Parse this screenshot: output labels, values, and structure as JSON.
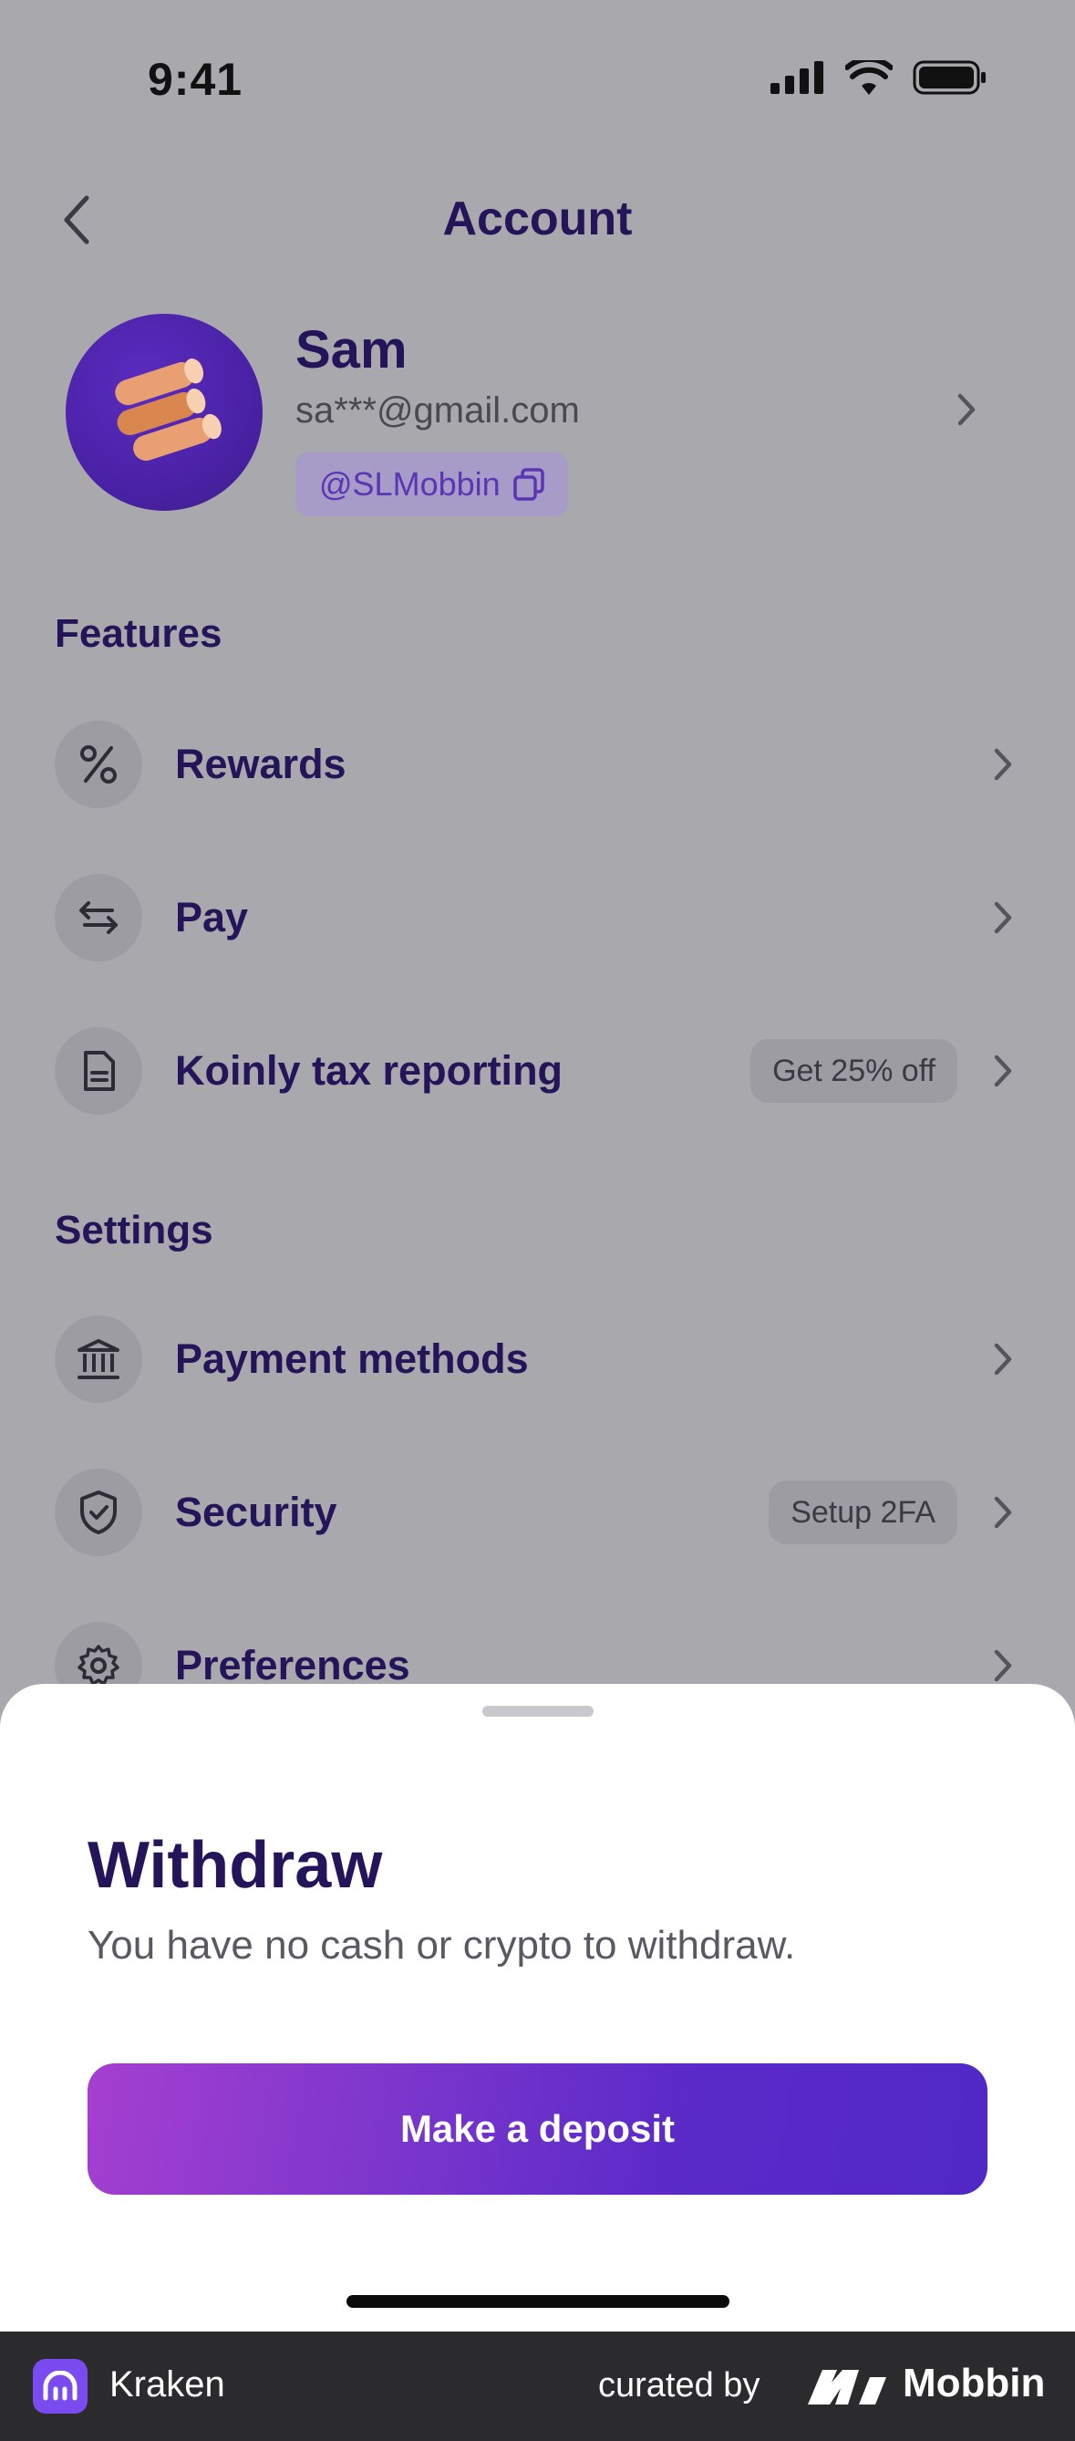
{
  "status_bar": {
    "time": "9:41"
  },
  "header": {
    "title": "Account"
  },
  "profile": {
    "name": "Sam",
    "email": "sa***@gmail.com",
    "handle": "@SLMobbin"
  },
  "features": {
    "title": "Features",
    "items": [
      {
        "label": "Rewards",
        "icon": "percent-icon",
        "badge": ""
      },
      {
        "label": "Pay",
        "icon": "transfer-arrows-icon",
        "badge": ""
      },
      {
        "label": "Koinly tax reporting",
        "icon": "document-icon",
        "badge": "Get 25% off"
      }
    ]
  },
  "settings": {
    "title": "Settings",
    "items": [
      {
        "label": "Payment methods",
        "icon": "bank-icon",
        "badge": ""
      },
      {
        "label": "Security",
        "icon": "shield-check-icon",
        "badge": "Setup 2FA"
      },
      {
        "label": "Preferences",
        "icon": "gear-icon",
        "badge": ""
      }
    ]
  },
  "sheet": {
    "title": "Withdraw",
    "subtitle": "You have no cash or crypto to withdraw.",
    "button_label": "Make a deposit"
  },
  "footer": {
    "app_name": "Kraken",
    "curated_by": "curated by",
    "brand": "Mobbin"
  },
  "colors": {
    "accent": "#5b2ac9",
    "accent_start": "#a53fd0",
    "title_text": "#24145a"
  }
}
